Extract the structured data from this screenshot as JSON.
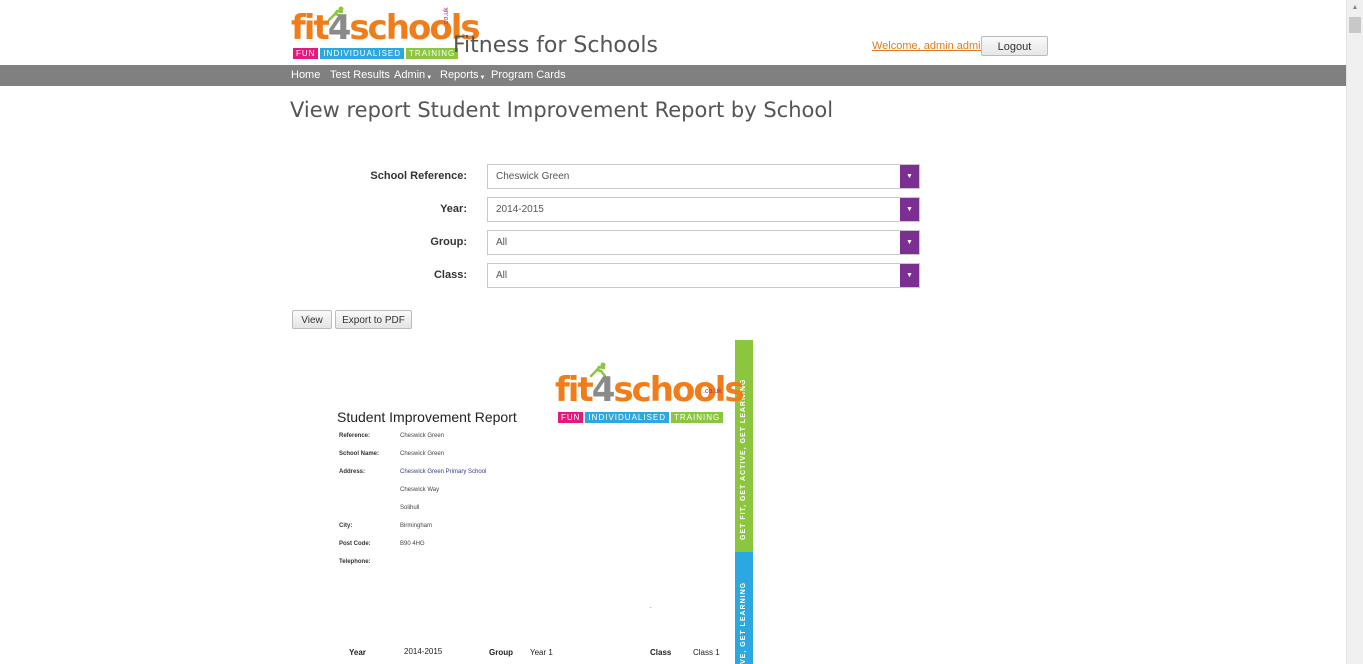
{
  "header": {
    "logo": {
      "text_fit": "fit",
      "text_four": "4",
      "text_schools": "schools",
      "couk": ".co.uk",
      "strip": [
        "FUN",
        "INDIVIDUALISED",
        "TRAINING"
      ]
    },
    "site_title": "Fitness for Schools",
    "welcome": "Welcome, admin admin",
    "logout_label": "Logout"
  },
  "nav": {
    "items": [
      {
        "label": "Home"
      },
      {
        "label": "Test Results"
      },
      {
        "label": "Admin",
        "has_menu": true
      },
      {
        "label": "Reports",
        "has_menu": true
      },
      {
        "label": "Program Cards"
      }
    ],
    "caret": "▼"
  },
  "main": {
    "title": "View report Student Improvement Report by School",
    "filters": [
      {
        "label": "School Reference:",
        "value": "Cheswick Green"
      },
      {
        "label": "Year:",
        "value": "2014-2015"
      },
      {
        "label": "Group:",
        "value": "All"
      },
      {
        "label": "Class:",
        "value": "All"
      }
    ],
    "dropdown_arrow": "▼",
    "view_label": "View",
    "export_label": "Export to PDF"
  },
  "report": {
    "title": "Student Improvement Report",
    "side_text_green": "GET FIT, GET ACTIVE, GET LEARNING",
    "side_text_blue": "VE, GET LEARNING",
    "details": [
      {
        "label": "Reference:",
        "value": "Cheswick Green"
      },
      {
        "label": "School Name:",
        "value": "Cheswick Green"
      },
      {
        "label": "Address:",
        "value": "Cheswick Green Primary School"
      },
      {
        "label": "",
        "value": "Cheswick Way"
      },
      {
        "label": "",
        "value": "Solihull"
      },
      {
        "label": "City:",
        "value": "Birmingham"
      },
      {
        "label": "Post Code:",
        "value": "B90 4HG"
      },
      {
        "label": "Telephone:",
        "value": ""
      }
    ],
    "dot": ".",
    "footer": {
      "year_label": "Year",
      "year_value": "2014-2015",
      "group_label": "Group",
      "group_value": "Year 1",
      "class_label": "Class",
      "class_value": "Class 1"
    }
  },
  "colors": {
    "nav_bg": "#808080",
    "accent_purple": "#7b2f93",
    "brand_orange": "#f07d1a",
    "brand_green": "#8cc63f",
    "brand_blue": "#2aa8df",
    "brand_pink": "#e5197b"
  }
}
